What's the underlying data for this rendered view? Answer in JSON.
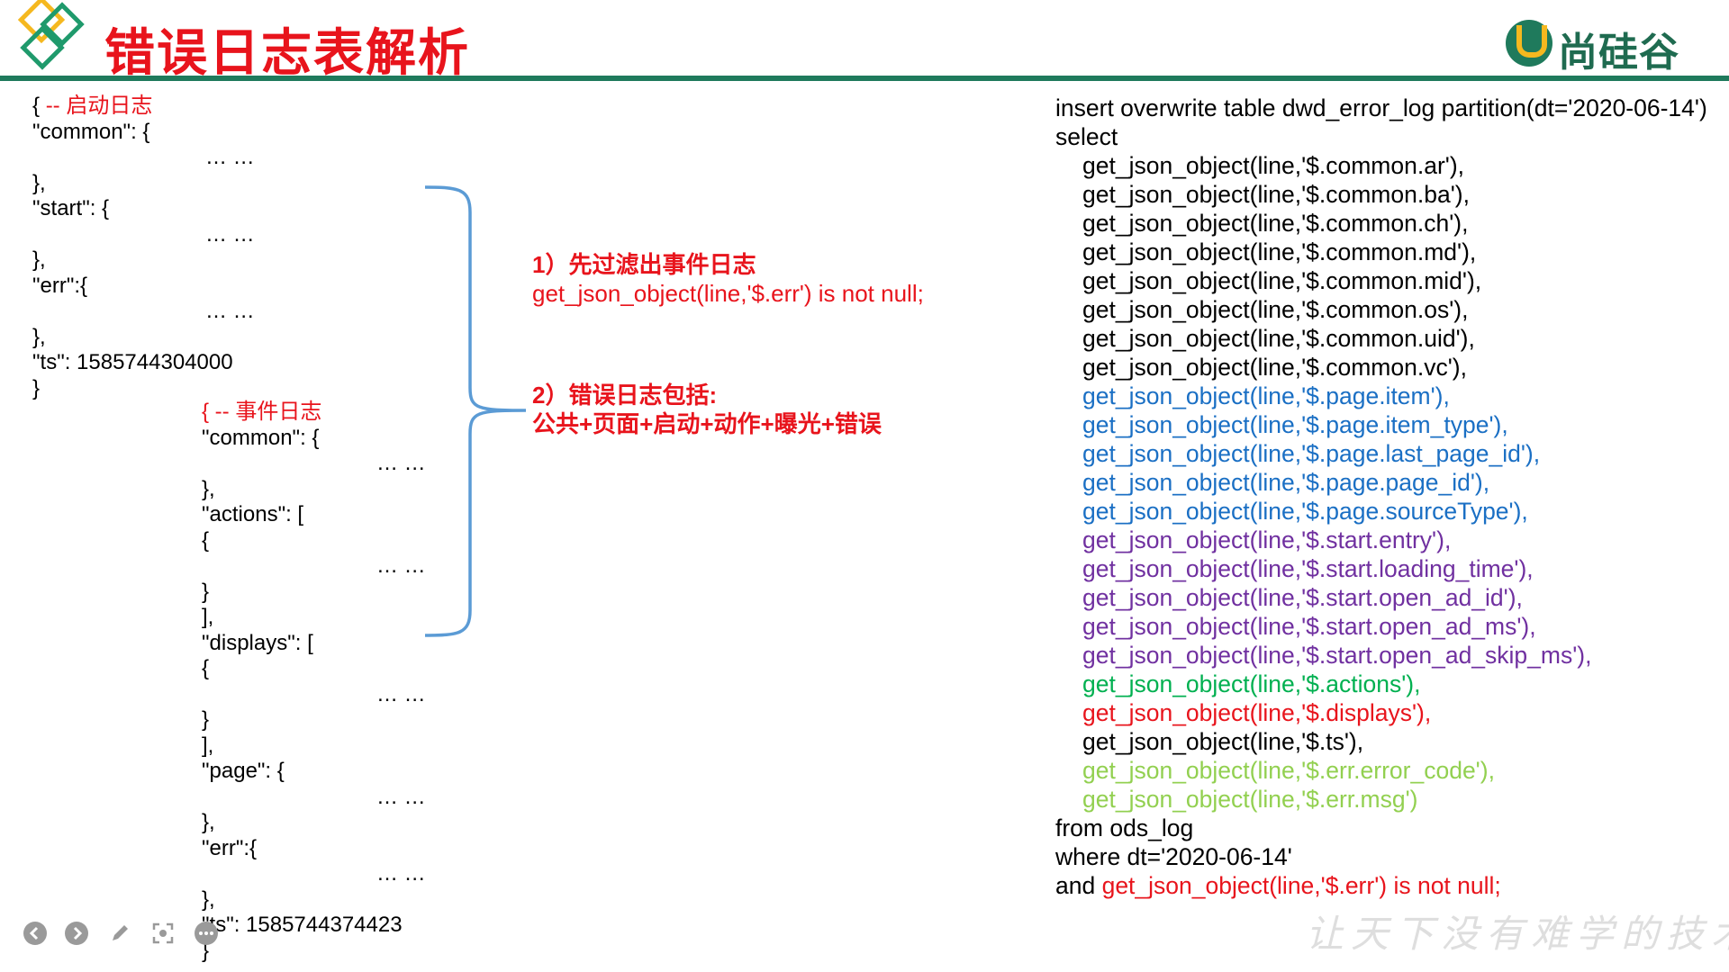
{
  "title": "错误日志表解析",
  "brand": {
    "name": "尚硅谷"
  },
  "slogan": "让天下没有难学的技术",
  "start_log": {
    "lines": [
      {
        "indent": 0,
        "text": "{ ",
        "comment": "-- 启动日志"
      },
      {
        "indent": 0,
        "text": "\"common\": {"
      },
      {
        "indent": 2,
        "text": "… …"
      },
      {
        "indent": 0,
        "text": "},"
      },
      {
        "indent": 0,
        "text": "\"start\": {"
      },
      {
        "indent": 2,
        "text": "… …"
      },
      {
        "indent": 0,
        "text": "},"
      },
      {
        "indent": 0,
        "text": "\"err\":{"
      },
      {
        "indent": 2,
        "text": "… …"
      },
      {
        "indent": 0,
        "text": "},"
      },
      {
        "indent": 0,
        "text": "\"ts\": 1585744304000"
      },
      {
        "indent": 0,
        "text": "}"
      }
    ]
  },
  "event_log": {
    "lines": [
      {
        "indent": 1,
        "text": "",
        "comment": "{ -- 事件日志"
      },
      {
        "indent": 1,
        "text": "\"common\": {"
      },
      {
        "indent": 3,
        "text": "… …"
      },
      {
        "indent": 1,
        "text": "},"
      },
      {
        "indent": 1,
        "text": "\"actions\": ["
      },
      {
        "indent": 1,
        "text": "{"
      },
      {
        "indent": 3,
        "text": "… …"
      },
      {
        "indent": 1,
        "text": "}"
      },
      {
        "indent": 1,
        "text": "],"
      },
      {
        "indent": 1,
        "text": "\"displays\": ["
      },
      {
        "indent": 1,
        "text": "{"
      },
      {
        "indent": 3,
        "text": "… …"
      },
      {
        "indent": 1,
        "text": "}"
      },
      {
        "indent": 1,
        "text": "],"
      },
      {
        "indent": 1,
        "text": "\"page\": {"
      },
      {
        "indent": 3,
        "text": "… …"
      },
      {
        "indent": 1,
        "text": "},"
      },
      {
        "indent": 1,
        "text": "\"err\":{"
      },
      {
        "indent": 3,
        "text": "… …"
      },
      {
        "indent": 1,
        "text": "},"
      },
      {
        "indent": 1,
        "text": "\"ts\": 1585744374423"
      },
      {
        "indent": 1,
        "text": "}"
      }
    ]
  },
  "notes": {
    "n1_title": "1）先过滤出事件日志",
    "n1_body": "get_json_object(line,'$.err') is not null;",
    "n2_title": "2）错误日志包括:",
    "n2_body": "公共+页面+启动+动作+曝光+错误"
  },
  "sql": {
    "colors": {
      "black": "#000000",
      "blue": "#1a6fc4",
      "purple": "#7030a0",
      "green": "#00b050",
      "red": "#e8141c",
      "lime": "#92d050"
    },
    "lines": [
      {
        "indent": 0,
        "color": "black",
        "text": "insert overwrite table dwd_error_log partition(dt='2020-06-14')"
      },
      {
        "indent": 0,
        "color": "black",
        "text": "select"
      },
      {
        "indent": 1,
        "color": "black",
        "text": "get_json_object(line,'$.common.ar'),"
      },
      {
        "indent": 1,
        "color": "black",
        "text": "get_json_object(line,'$.common.ba'),"
      },
      {
        "indent": 1,
        "color": "black",
        "text": "get_json_object(line,'$.common.ch'),"
      },
      {
        "indent": 1,
        "color": "black",
        "text": "get_json_object(line,'$.common.md'),"
      },
      {
        "indent": 1,
        "color": "black",
        "text": "get_json_object(line,'$.common.mid'),"
      },
      {
        "indent": 1,
        "color": "black",
        "text": "get_json_object(line,'$.common.os'),"
      },
      {
        "indent": 1,
        "color": "black",
        "text": "get_json_object(line,'$.common.uid'),"
      },
      {
        "indent": 1,
        "color": "black",
        "text": "get_json_object(line,'$.common.vc'),"
      },
      {
        "indent": 1,
        "color": "blue",
        "text": "get_json_object(line,'$.page.item'),"
      },
      {
        "indent": 1,
        "color": "blue",
        "text": "get_json_object(line,'$.page.item_type'),"
      },
      {
        "indent": 1,
        "color": "blue",
        "text": "get_json_object(line,'$.page.last_page_id'),"
      },
      {
        "indent": 1,
        "color": "blue",
        "text": "get_json_object(line,'$.page.page_id'),"
      },
      {
        "indent": 1,
        "color": "blue",
        "text": "get_json_object(line,'$.page.sourceType'),"
      },
      {
        "indent": 1,
        "color": "purple",
        "text": "get_json_object(line,'$.start.entry'),"
      },
      {
        "indent": 1,
        "color": "purple",
        "text": "get_json_object(line,'$.start.loading_time'),"
      },
      {
        "indent": 1,
        "color": "purple",
        "text": "get_json_object(line,'$.start.open_ad_id'),"
      },
      {
        "indent": 1,
        "color": "purple",
        "text": "get_json_object(line,'$.start.open_ad_ms'),"
      },
      {
        "indent": 1,
        "color": "purple",
        "text": "get_json_object(line,'$.start.open_ad_skip_ms'),"
      },
      {
        "indent": 1,
        "color": "green",
        "text": "get_json_object(line,'$.actions'),"
      },
      {
        "indent": 1,
        "color": "red",
        "text": "get_json_object(line,'$.displays'),"
      },
      {
        "indent": 1,
        "color": "black",
        "text": "get_json_object(line,'$.ts'),"
      },
      {
        "indent": 1,
        "color": "lime",
        "text": "get_json_object(line,'$.err.error_code'),"
      },
      {
        "indent": 1,
        "color": "lime",
        "text": "get_json_object(line,'$.err.msg')"
      },
      {
        "indent": 0,
        "color": "black",
        "text": "from ods_log"
      },
      {
        "indent": 0,
        "color": "black",
        "text": "where dt='2020-06-14'"
      },
      {
        "indent": 0,
        "color": "black",
        "text": "and ",
        "tail": "get_json_object(line,'$.err') is not null;",
        "tail_color": "red"
      }
    ]
  },
  "player_icons": [
    "prev-icon",
    "next-icon",
    "pen-icon",
    "focus-icon",
    "more-icon"
  ]
}
